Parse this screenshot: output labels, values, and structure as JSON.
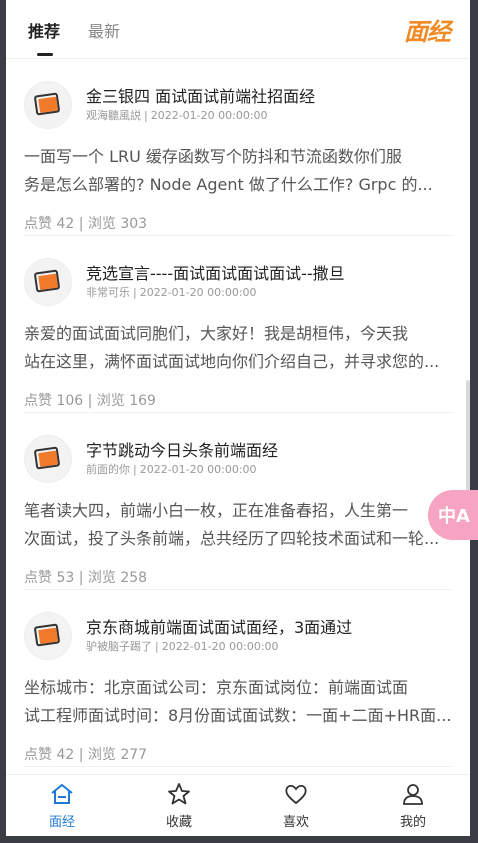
{
  "tabs": [
    {
      "label": "推荐",
      "active": true
    },
    {
      "label": "最新",
      "active": false
    }
  ],
  "logo_text": "面经",
  "articles": [
    {
      "title": "金三银四 面试面试前端社招面经",
      "author": "观海聽風説",
      "date": "2022-01-20 00:00:00",
      "excerpt_lines": [
        "一面写一个 LRU 缓存函数写个防抖和节流函数你们服",
        "务是怎么部署的? Node Agent 做了什么工作? Grpc 的..."
      ],
      "likes_text": "点赞 42 | 浏览 303"
    },
    {
      "title": "竞选宣言----面试面试面试面试--撒旦",
      "author": "非常可乐",
      "date": "2022-01-20 00:00:00",
      "excerpt_lines": [
        "亲爱的面试面试同胞们，大家好！我是胡桓伟，今天我",
        "站在这里，满怀面试面试地向你们介绍自己，并寻求您的..."
      ],
      "likes_text": "点赞 106 | 浏览 169"
    },
    {
      "title": "字节跳动今日头条前端面经",
      "author": "前面的你",
      "date": "2022-01-20 00:00:00",
      "excerpt_lines": [
        "笔者读大四，前端小白一枚，正在准备春招，人生第一",
        "次面试，投了头条前端，总共经历了四轮技术面试和一轮..."
      ],
      "likes_text": "点赞 53 | 浏览 258"
    },
    {
      "title": "京东商城前端面试面试面经，3面通过",
      "author": "驴被脑子踢了",
      "date": "2022-01-20 00:00:00",
      "excerpt_lines": [
        "坐标城市：北京面试公司：京东面试岗位：前端面试面",
        "试工程师面试时间：8月份面试面试数：一面+二面+HR面..."
      ],
      "likes_text": "点赞 42 | 浏览 277"
    }
  ],
  "bottom_nav": [
    {
      "label": "面经",
      "icon": "home-icon",
      "active": true
    },
    {
      "label": "收藏",
      "icon": "star-icon",
      "active": false
    },
    {
      "label": "喜欢",
      "icon": "heart-icon",
      "active": false
    },
    {
      "label": "我的",
      "icon": "user-icon",
      "active": false
    }
  ],
  "floating_button": {
    "label": "中A",
    "icon": "translate-icon"
  },
  "colors": {
    "accent": "#1e7ad6",
    "logo": "#f08a24",
    "avatar_icon": "#f07a2a"
  }
}
